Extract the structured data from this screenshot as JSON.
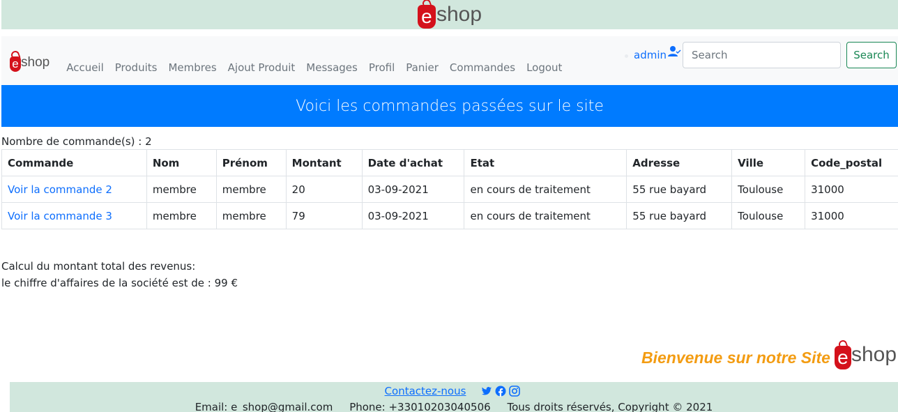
{
  "brand": {
    "logo_letter": "e",
    "logo_text": "shop"
  },
  "nav": {
    "items": [
      "Accueil",
      "Produits",
      "Membres",
      "Ajout Produit",
      "Messages",
      "Profil",
      "Panier",
      "Commandes",
      "Logout"
    ],
    "user_label": "admin",
    "search_placeholder": "Search",
    "search_button": "Search"
  },
  "colors": {
    "banner_bg": "#d1e7dd",
    "header_bg": "#007bff",
    "link": "#0d6efd",
    "search_accent": "#198754",
    "welcome": "#f39c12",
    "logo_red": "#d4111b"
  },
  "page": {
    "title": "Voici les commandes passées sur le site",
    "order_count": "Nombre de commande(s) : 2"
  },
  "table": {
    "headers": [
      "Commande",
      "Nom",
      "Prénom",
      "Montant",
      "Date d'achat",
      "Etat",
      "Adresse",
      "Ville",
      "Code_postal"
    ],
    "rows": [
      [
        "Voir la commande 2",
        "membre",
        "membre",
        "20",
        "03-09-2021",
        "en cours de traitement",
        "55 rue bayard",
        "Toulouse",
        "31000"
      ],
      [
        "Voir la commande 3",
        "membre",
        "membre",
        "79",
        "03-09-2021",
        "en cours de traitement",
        "55 rue bayard",
        "Toulouse",
        "31000"
      ]
    ]
  },
  "revenue": {
    "label": "Calcul du montant total des revenus:",
    "value": "le chiffre d'affaires de la société est de : 99 €"
  },
  "welcome": "Bienvenue sur notre Site",
  "footer": {
    "contact": "Contactez-nous",
    "social_icons": [
      "twitter-icon",
      "facebook-icon",
      "instagram-icon"
    ],
    "email": "Email: e_shop@gmail.com",
    "phone": "Phone: +33010203040506",
    "copyright": "Tous droits réservés, Copyright © 2021"
  }
}
